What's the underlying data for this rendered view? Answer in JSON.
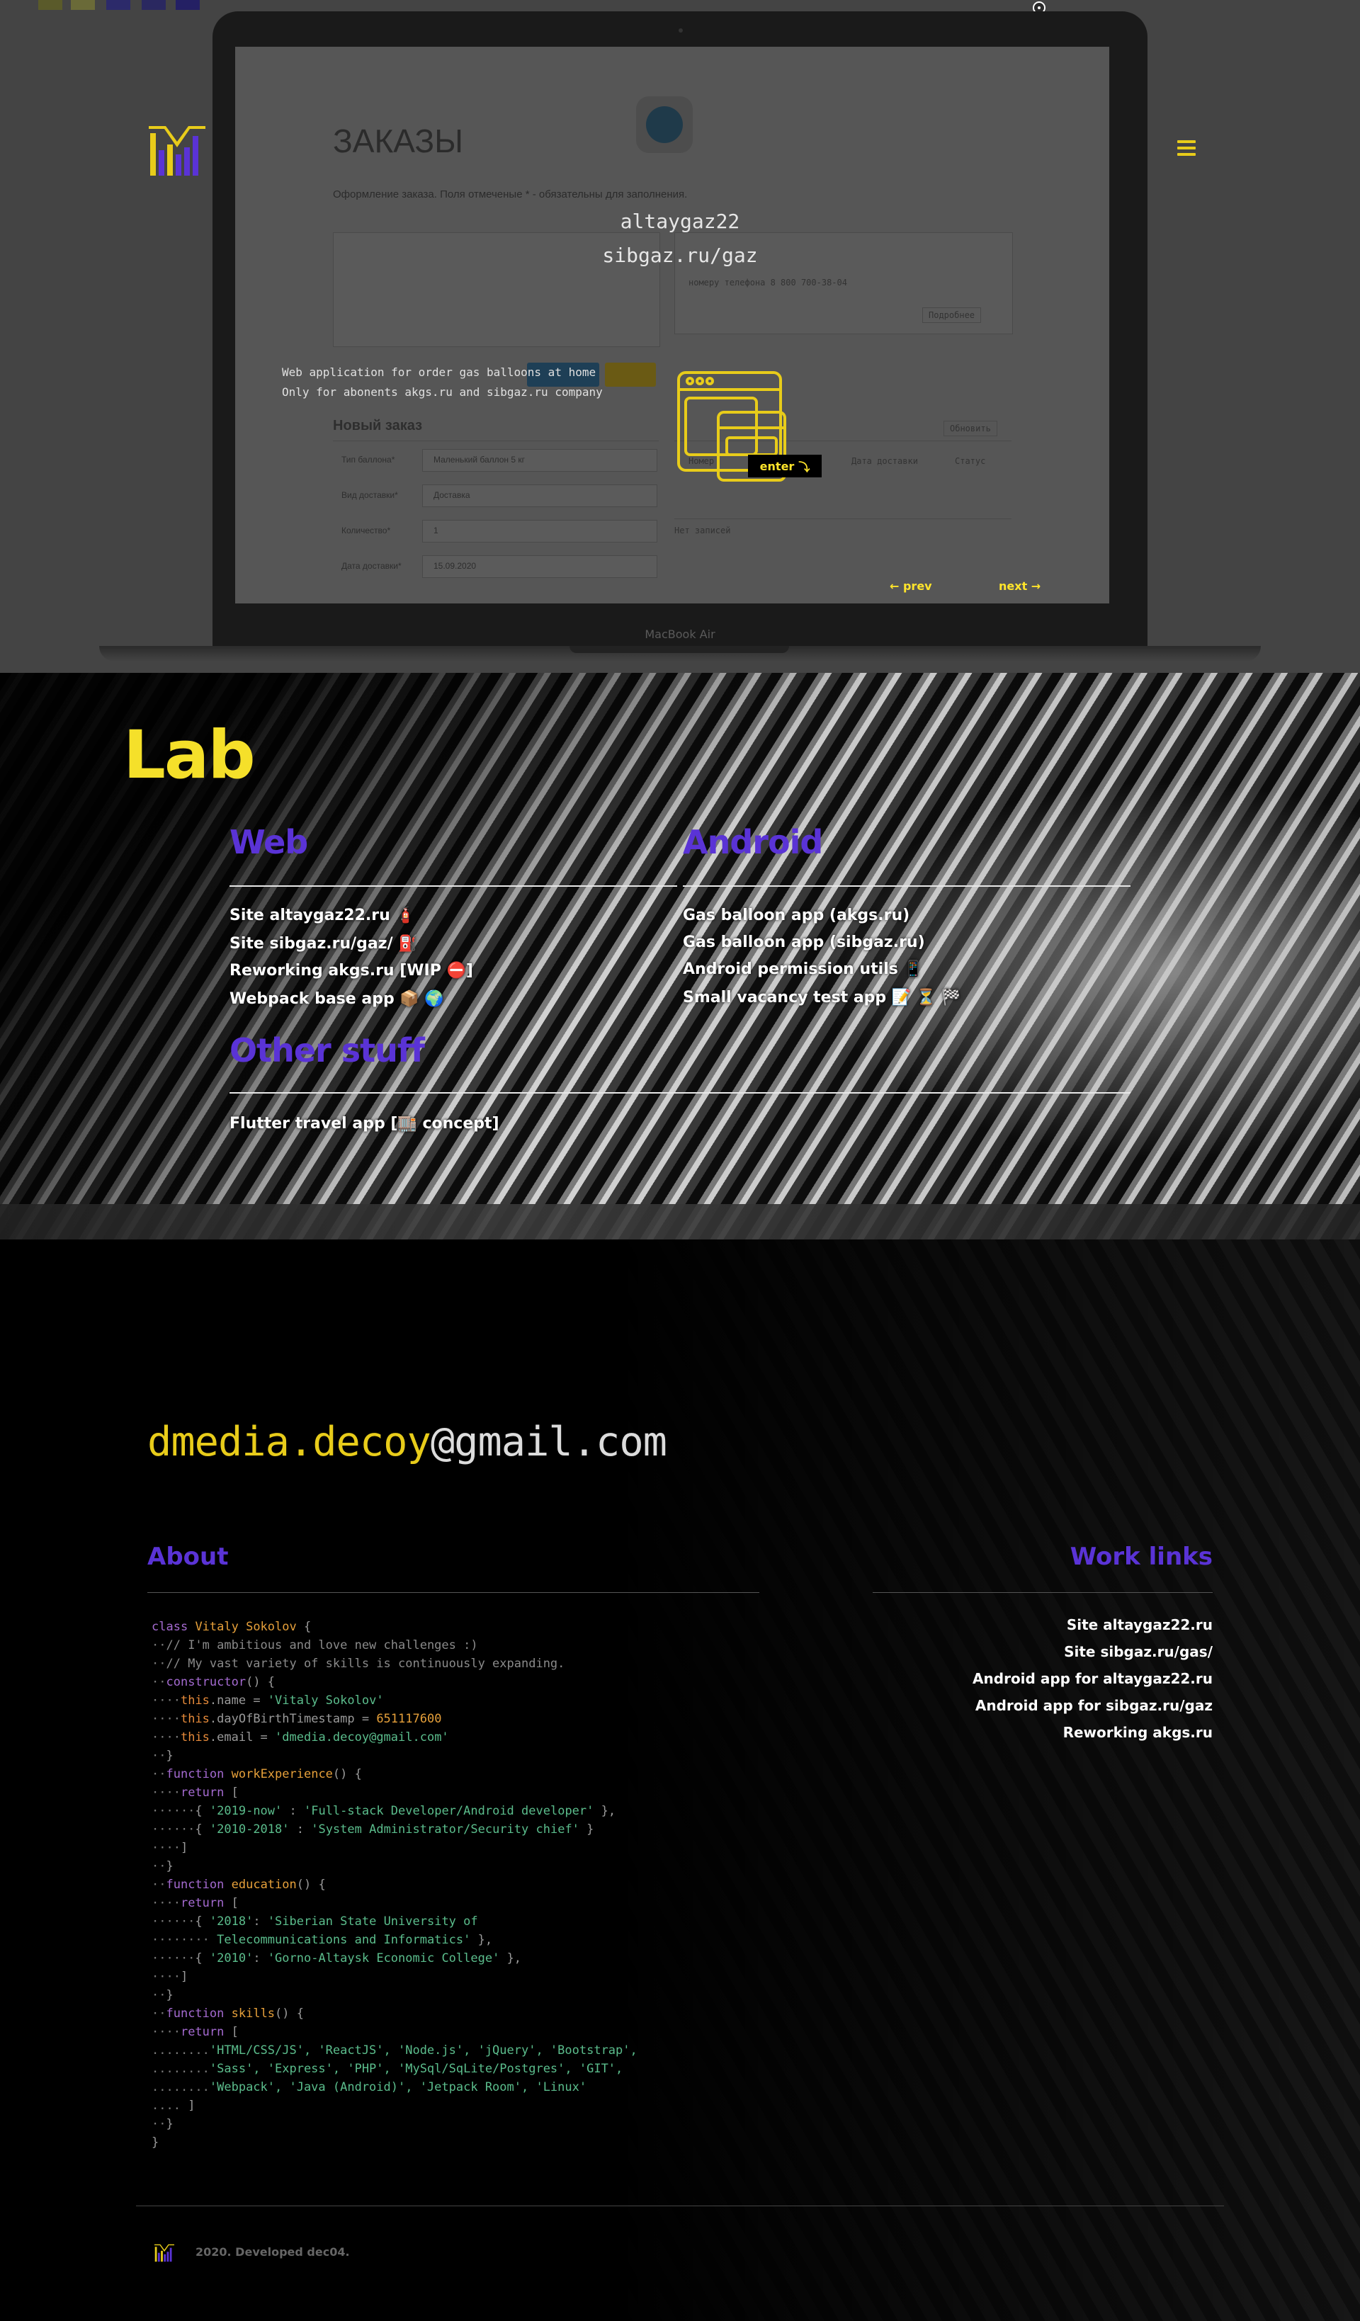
{
  "colors": {
    "accent_yellow": "#f5e02a",
    "accent_purple": "#5a33d6",
    "hero_bg": "#444444",
    "swatches": [
      "#5a5a2a",
      "#6a6a38",
      "#2c2a6a",
      "#2a2860",
      "#242064"
    ]
  },
  "hero": {
    "logo_icon": "dm-bars-logo-icon",
    "menu_icon": "hamburger-menu-icon",
    "project_name": "altaygaz22",
    "project_site": "sibgaz.ru/gaz",
    "description_line1": "Web application for order gas balloons at home",
    "description_line2": "Only for abonents akgs.ru and sibgaz.ru company",
    "app_icon": "app-windows-icon",
    "enter_label": "enter",
    "enter_icon": "⤵",
    "prev_label": "← prev",
    "next_label": "next →",
    "laptop_label": "MacBook Air",
    "screen": {
      "title": "ЗАКАЗЫ",
      "subtitle": "Оформление заказа. Поля отмеченые * - обязательны для заполнения.",
      "new_order": "Новый заказ",
      "fields": [
        {
          "label": "Тип баллона*",
          "value": "Маленький баллон 5 кг"
        },
        {
          "label": "Вид доставки*",
          "value": "Доставка"
        },
        {
          "label": "Количество*",
          "value": "1"
        },
        {
          "label": "Дата доставки*",
          "value": "15.09.2020"
        }
      ],
      "table_headers": [
        "Номер",
        "Дата доставки",
        "Статус"
      ],
      "empty_text": "Нет записей",
      "refresh_label": "Обновить",
      "more_label": "Подробнее",
      "phone_note": "номеру телефона 8 800 700-38-04"
    }
  },
  "lab": {
    "title": "Lab",
    "web": {
      "heading": "Web",
      "items": [
        "Site altaygaz22.ru 🧯",
        "Site sibgaz.ru/gaz/ ⛽",
        "Reworking akgs.ru [WIP ⛔]",
        "Webpack base app 📦 🌍"
      ]
    },
    "android": {
      "heading": "Android",
      "items": [
        "Gas balloon app (akgs.ru)",
        "Gas balloon app (sibgaz.ru)",
        "Android permission utils 📱",
        "Small vacancy test app 📝 ⏳ 🏁"
      ]
    },
    "other": {
      "heading": "Other stuff",
      "items": [
        "Flutter travel app [🏬 concept]"
      ]
    }
  },
  "contact": {
    "email_user": "dmedia.decoy",
    "email_domain": "@gmail.com"
  },
  "about": {
    "title": "About",
    "code": {
      "class_kw": "class",
      "class_name": "Vitaly Sokolov",
      "comment1": "// I'm ambitious and love new challenges :)",
      "comment2": "// My vast variety of skills is continuously expanding.",
      "constructor": "constructor",
      "name_prop": ".name = ",
      "name_val": "'Vitaly Sokolov'",
      "dob_prop": ".dayOfBirthTimestamp = ",
      "dob_val": "651117600",
      "email_prop": ".email = ",
      "email_val": "'dmedia.decoy@gmail.com'",
      "fn_work": "workExperience",
      "work1_key": "'2019-now'",
      "work1_val": "'Full-stack Developer/Android developer'",
      "work2_key": "'2010-2018'",
      "work2_val": "'System Administrator/Security chief'",
      "fn_edu": "education",
      "edu1_key": "'2018'",
      "edu1_val_a": "'Siberian State University of",
      "edu1_val_b": "Telecommunications and Informatics'",
      "edu2_key": "'2010'",
      "edu2_val": "'Gorno-Altaysk Economic College'",
      "fn_skills": "skills",
      "skills1": "'HTML/CSS/JS', 'ReactJS', 'Node.js', 'jQuery', 'Bootstrap',",
      "skills2": "'Sass', 'Express', 'PHP', 'MySql/SqLite/Postgres', 'GIT',",
      "skills3": "'Webpack', 'Java (Android)', 'Jetpack Room', 'Linux'"
    }
  },
  "work_links": {
    "title": "Work links",
    "items": [
      "Site altaygaz22.ru",
      "Site sibgaz.ru/gas/",
      "Android app for altaygaz22.ru",
      "Android app for sibgaz.ru/gaz",
      "Reworking akgs.ru"
    ]
  },
  "footer": {
    "text": "2020. Developed dec04."
  }
}
